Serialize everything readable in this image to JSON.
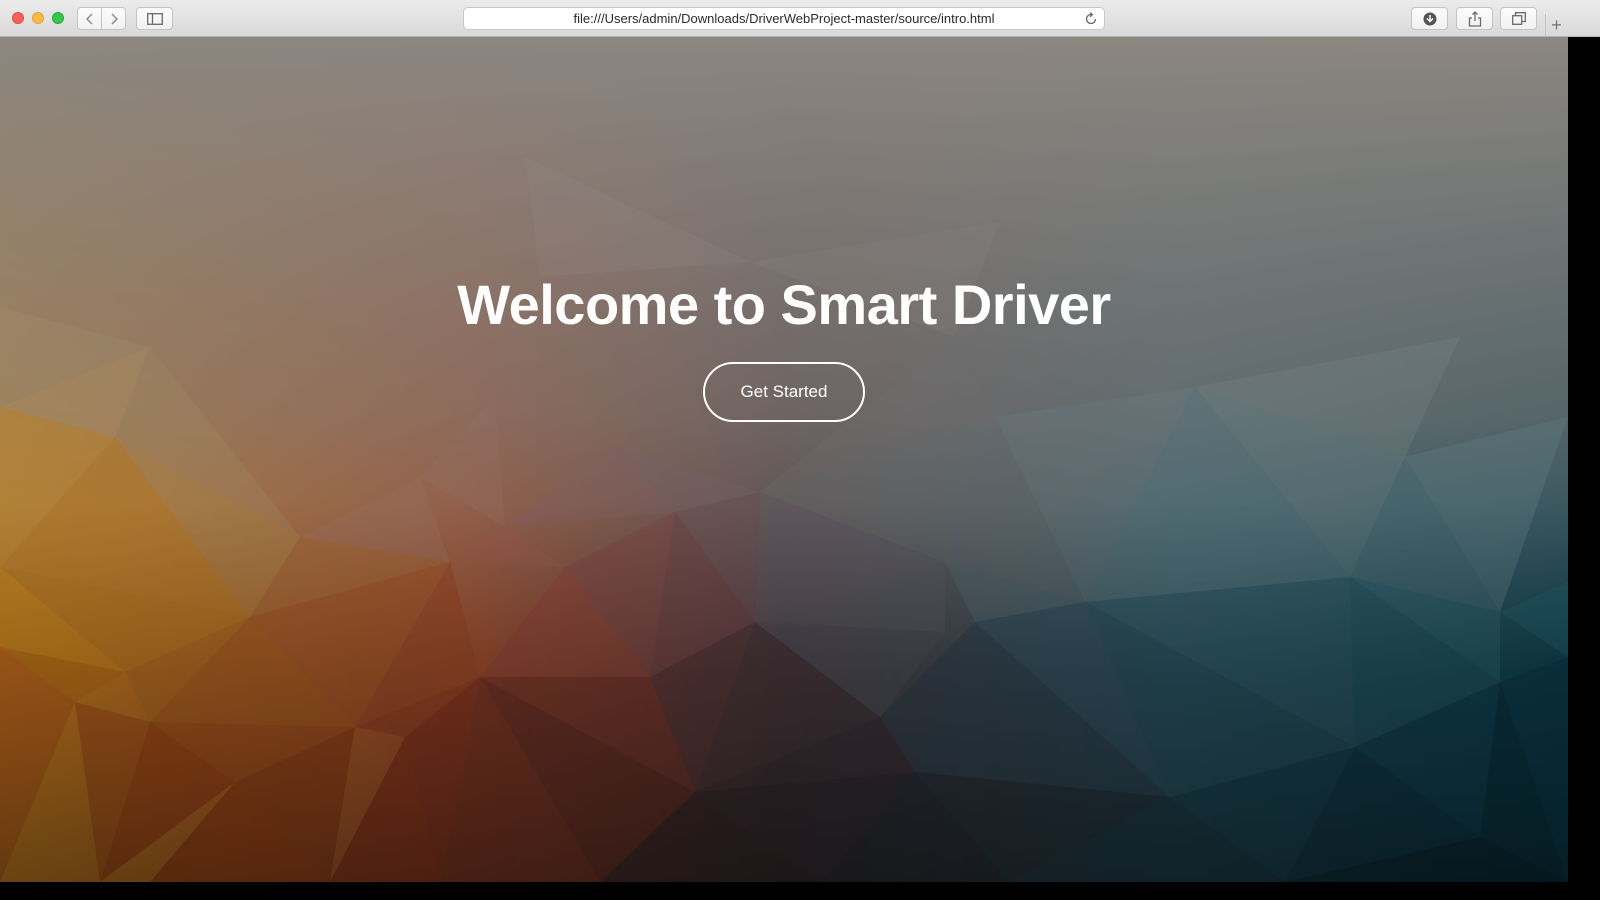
{
  "browser": {
    "url": "file:///Users/admin/Downloads/DriverWebProject-master/source/intro.html",
    "new_tab_label": "+"
  },
  "hero": {
    "title": "Welcome to Smart Driver",
    "button_label": "Get Started"
  },
  "colors": {
    "top_gray": "#8a8580",
    "orange": "#c4711e",
    "rust": "#8a3a26",
    "teal": "#1f5a6a",
    "dark": "#1a1d22"
  }
}
